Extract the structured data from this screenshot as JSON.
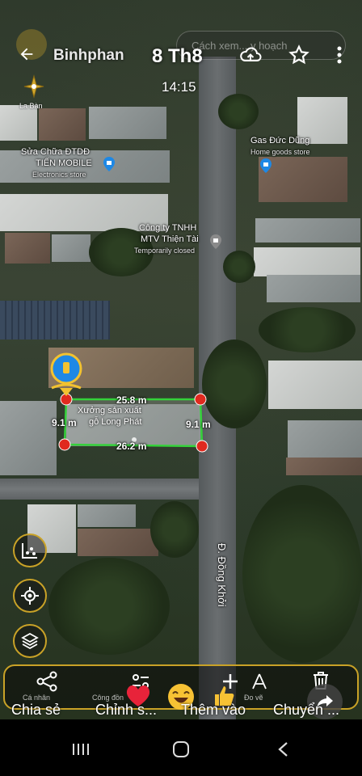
{
  "header": {
    "title": "Binhphan",
    "date": "8 Th8",
    "time": "14:15",
    "search_hint": "Cách xem... y hoạch"
  },
  "compass": {
    "label": "La Bàn"
  },
  "map_labels": {
    "repair_shop": "Sửa Chữa ĐTDĐ",
    "repair_shop_2": "TIẾN MOBILE",
    "repair_shop_sub": "Electronics store",
    "gas_shop": "Gas Đức Dũng",
    "gas_shop_sub": "Home goods store",
    "company": "Công ty TNHH",
    "company_2": "MTV Thiện Tài",
    "company_sub": "Temporarily closed",
    "factory": "Xưởng sản xuất",
    "factory_2": "gỗ Long Phát",
    "street": "Đ. Đồng Khởi"
  },
  "measurement": {
    "top": "25.8 m",
    "bottom": "26.2 m",
    "left": "9.1 m",
    "right": "9.1 m"
  },
  "bottom_ghost": {
    "left": "Cá nhân",
    "mid": "Công đồn",
    "right": "Đo vẽ"
  },
  "actions": [
    {
      "label": "Chia sẻ"
    },
    {
      "label": "Chỉnh s..."
    },
    {
      "label": "Thêm vào"
    },
    {
      "label": "Chuyển ..."
    }
  ],
  "colors": {
    "accent": "#c9a227",
    "measure_line": "#34d23a",
    "measure_point": "#e02a1f",
    "pin": "#1e88e5"
  },
  "icons": {
    "back": "arrow-left-icon",
    "upload": "cloud-upload-icon",
    "star": "star-icon",
    "more": "more-vert-icon",
    "compass": "compass-icon",
    "chart": "chart-icon",
    "locate": "locate-icon",
    "layers": "layers-icon",
    "share": "share-icon",
    "edit": "edit-icon",
    "add": "add-icon",
    "trash": "trash-icon"
  }
}
